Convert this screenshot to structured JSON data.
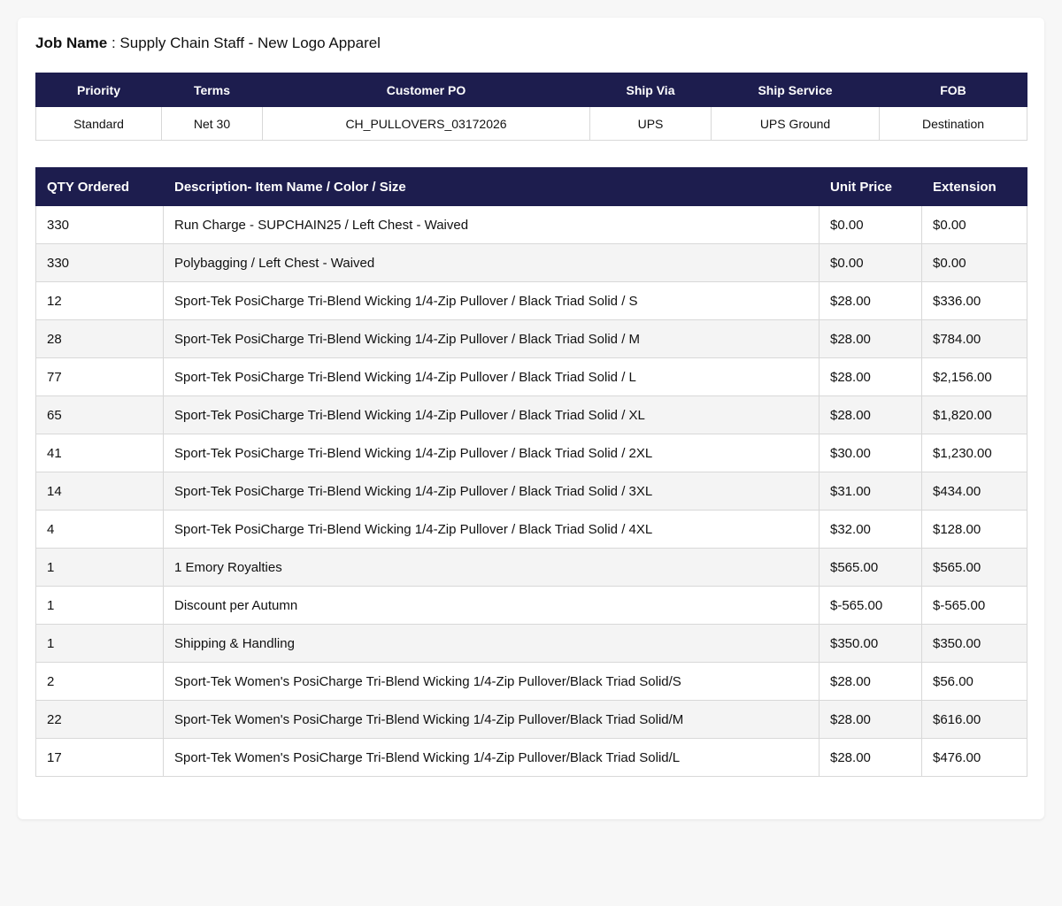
{
  "job": {
    "label": "Job Name",
    "separator": " : ",
    "value": "Supply Chain Staff - New Logo Apparel"
  },
  "order_meta": {
    "headers": [
      "Priority",
      "Terms",
      "Customer PO",
      "Ship Via",
      "Ship Service",
      "FOB"
    ],
    "values": [
      "Standard",
      "Net 30",
      "CH_PULLOVERS_03172026",
      "UPS",
      "UPS Ground",
      "Destination"
    ]
  },
  "line_items": {
    "headers": [
      "QTY Ordered",
      "Description- Item Name / Color / Size",
      "Unit Price",
      "Extension"
    ],
    "rows": [
      [
        "330",
        "Run Charge - SUPCHAIN25 / Left Chest - Waived",
        "$0.00",
        "$0.00"
      ],
      [
        "330",
        "Polybagging / Left Chest - Waived",
        "$0.00",
        "$0.00"
      ],
      [
        "12",
        "Sport-Tek PosiCharge Tri-Blend Wicking 1/4-Zip Pullover / Black Triad Solid / S",
        "$28.00",
        "$336.00"
      ],
      [
        "28",
        "Sport-Tek PosiCharge Tri-Blend Wicking 1/4-Zip Pullover / Black Triad Solid / M",
        "$28.00",
        "$784.00"
      ],
      [
        "77",
        "Sport-Tek PosiCharge Tri-Blend Wicking 1/4-Zip Pullover / Black Triad Solid / L",
        "$28.00",
        "$2,156.00"
      ],
      [
        "65",
        "Sport-Tek PosiCharge Tri-Blend Wicking 1/4-Zip Pullover / Black Triad Solid / XL",
        "$28.00",
        "$1,820.00"
      ],
      [
        "41",
        "Sport-Tek PosiCharge Tri-Blend Wicking 1/4-Zip Pullover / Black Triad Solid / 2XL",
        "$30.00",
        "$1,230.00"
      ],
      [
        "14",
        "Sport-Tek PosiCharge Tri-Blend Wicking 1/4-Zip Pullover / Black Triad Solid / 3XL",
        "$31.00",
        "$434.00"
      ],
      [
        "4",
        "Sport-Tek PosiCharge Tri-Blend Wicking 1/4-Zip Pullover / Black Triad Solid / 4XL",
        "$32.00",
        "$128.00"
      ],
      [
        "1",
        "1 Emory Royalties",
        "$565.00",
        "$565.00"
      ],
      [
        "1",
        "Discount per Autumn",
        "$-565.00",
        "$-565.00"
      ],
      [
        "1",
        "Shipping & Handling",
        "$350.00",
        "$350.00"
      ],
      [
        "2",
        "Sport-Tek Women's PosiCharge Tri-Blend Wicking 1/4-Zip Pullover/Black Triad Solid/S",
        "$28.00",
        "$56.00"
      ],
      [
        "22",
        "Sport-Tek Women's PosiCharge Tri-Blend Wicking 1/4-Zip Pullover/Black Triad Solid/M",
        "$28.00",
        "$616.00"
      ],
      [
        "17",
        "Sport-Tek Women's PosiCharge Tri-Blend Wicking 1/4-Zip Pullover/Black Triad Solid/L",
        "$28.00",
        "$476.00"
      ]
    ]
  },
  "colors": {
    "header_bg": "#1d1d4e",
    "header_text": "#ffffff",
    "row_alt_bg": "#f4f4f4",
    "border": "#d8d8d8"
  }
}
